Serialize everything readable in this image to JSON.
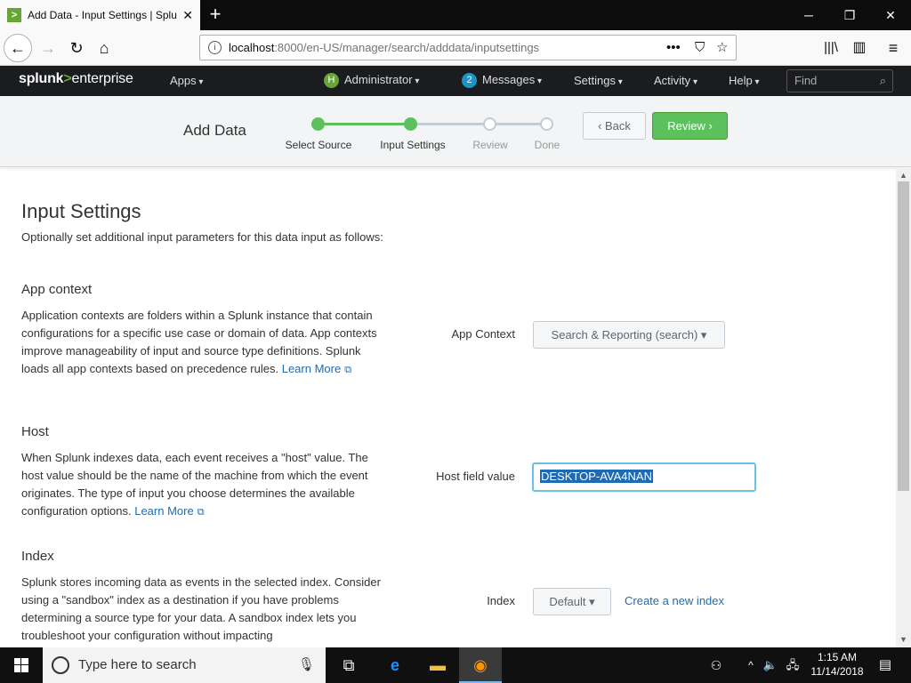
{
  "browser": {
    "tab_title": "Add Data - Input Settings | Splu",
    "url_host": "localhost",
    "url_rest": ":8000/en-US/manager/search/adddata/inputsettings"
  },
  "splunk_nav": {
    "logo_main": "splunk",
    "logo_gt": ">",
    "logo_rest": "enterprise",
    "apps": "Apps",
    "user_initial": "H",
    "user": "Administrator",
    "messages_count": "2",
    "messages": "Messages",
    "settings": "Settings",
    "activity": "Activity",
    "help": "Help",
    "find_placeholder": "Find",
    "colors": {
      "brand_green": "#65a637",
      "message_badge": "#1e93c6",
      "user_badge": "#65a637"
    }
  },
  "wizard": {
    "title": "Add Data",
    "steps": [
      {
        "label": "Select Source",
        "state": "done"
      },
      {
        "label": "Input Settings",
        "state": "current"
      },
      {
        "label": "Review",
        "state": "todo"
      },
      {
        "label": "Done",
        "state": "todo"
      }
    ],
    "back_label": "Back",
    "review_label": "Review"
  },
  "main": {
    "title": "Input Settings",
    "subtitle": "Optionally set additional input parameters for this data input as follows:",
    "app_context": {
      "heading": "App context",
      "description": "Application contexts are folders within a Splunk instance that contain configurations for a specific use case or domain of data. App contexts improve manageability of input and source type definitions. Splunk loads all app contexts based on precedence rules.",
      "learn_more": "Learn More",
      "field_label": "App Context",
      "selected": "Search & Reporting (search)"
    },
    "host": {
      "heading": "Host",
      "description": "When Splunk indexes data, each event receives a \"host\" value. The host value should be the name of the machine from which the event originates. The type of input you choose determines the available configuration options.",
      "learn_more": "Learn More",
      "field_label": "Host field value",
      "value": "DESKTOP-AVA4NAN"
    },
    "index": {
      "heading": "Index",
      "description": "Splunk stores incoming data as events in the selected index. Consider using a \"sandbox\" index as a destination if you have problems determining a source type for your data. A sandbox index lets you troubleshoot your configuration without impacting",
      "field_label": "Index",
      "selected": "Default",
      "create_link": "Create a new index"
    }
  },
  "taskbar": {
    "search_placeholder": "Type here to search",
    "time": "1:15 AM",
    "date": "11/14/2018"
  }
}
